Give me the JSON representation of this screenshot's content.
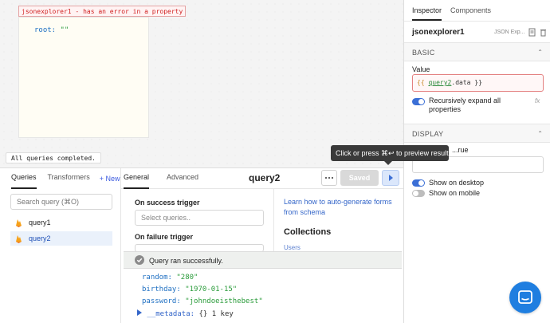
{
  "canvas": {
    "error_label": "jsonexplorer1 - has an error in a property",
    "json_key": "root:",
    "json_value": "\"\""
  },
  "status": {
    "message": "All queries completed."
  },
  "queries_panel": {
    "tabs": [
      "Queries",
      "Transformers"
    ],
    "new_label": "+ New",
    "search_placeholder": "Search query (⌘O)",
    "items": [
      {
        "name": "query1",
        "selected": false
      },
      {
        "name": "query2",
        "selected": true
      }
    ]
  },
  "editor": {
    "tabs": [
      "General",
      "Advanced"
    ],
    "query_name": "query2",
    "saved_label": "Saved",
    "on_success": {
      "label": "On success trigger",
      "placeholder": "Select queries.."
    },
    "on_failure": {
      "label": "On failure trigger"
    },
    "helper_link": "Learn how to auto-generate forms from schema",
    "collections_title": "Collections",
    "users_link": "Users"
  },
  "tooltip": {
    "text": "Click or press ⌘↩ to preview result."
  },
  "result": {
    "banner": "Query ran successfully.",
    "lines": [
      {
        "key": "random:",
        "value": "\"280\""
      },
      {
        "key": "birthday:",
        "value": "\"1970-01-15\""
      },
      {
        "key": "password:",
        "value": "\"johndoeisthebest\""
      }
    ],
    "meta_key": "__metadata:",
    "meta_value": "{} 1 key"
  },
  "inspector": {
    "tabs": [
      "Inspector",
      "Components"
    ],
    "component_name": "jsonexplorer1",
    "component_type": "JSON Exp...",
    "basic_section": "BASIC",
    "value_label": "Value",
    "value_open": "{{",
    "value_ref": "query2",
    "value_rest": ".data }}",
    "expand_label": "Recursively expand all properties",
    "fx_label": "fx",
    "display_section": "DISPLAY",
    "hidden_label": "...rue",
    "show_desktop": "Show on desktop",
    "show_mobile": "Show on mobile",
    "toggles": {
      "expand": true,
      "desktop": true,
      "mobile": false
    }
  },
  "colors": {
    "accent": "#3b6fd6",
    "error": "#d02020",
    "string": "#2a9b3a",
    "key": "#1e6fc2"
  }
}
